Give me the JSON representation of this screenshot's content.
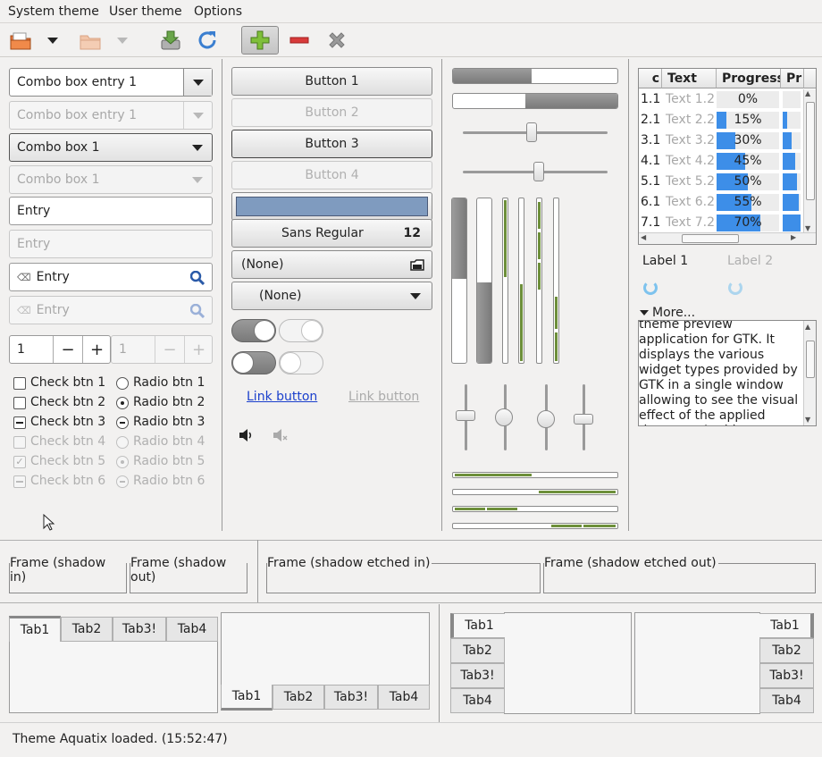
{
  "menubar": {
    "items": [
      "System theme",
      "User theme",
      "Options"
    ]
  },
  "toolbar": {
    "icons": [
      "open-icon",
      "dropdown-arrow-icon",
      "open-disabled-icon",
      "dropdown-arrow-disabled-icon",
      "save-icon",
      "refresh-icon",
      "add-icon",
      "remove-icon",
      "close-icon"
    ]
  },
  "col1": {
    "combo_entry_1": "Combo box entry 1",
    "combo_entry_1_dis": "Combo box entry 1",
    "combo_1": "Combo box 1",
    "combo_1_dis": "Combo box 1",
    "entry": "Entry",
    "entry_placeholder": "Entry",
    "search_entry": "Entry",
    "search_entry_dis": "Entry",
    "spin_value": "1",
    "spin_value_dis": "1",
    "spin_minus": "−",
    "spin_plus": "+",
    "checks": [
      "Check btn 1",
      "Check btn 2",
      "Check btn 3",
      "Check btn 4",
      "Check btn 5",
      "Check btn 6"
    ],
    "radios": [
      "Radio btn 1",
      "Radio btn 2",
      "Radio btn 3",
      "Radio btn 4",
      "Radio btn 5",
      "Radio btn 6"
    ]
  },
  "col2": {
    "buttons": [
      "Button 1",
      "Button 2",
      "Button 3",
      "Button 4"
    ],
    "color_button": "#7f9bbf",
    "font_name": "Sans Regular",
    "font_size": "12",
    "file_chooser": "(None)",
    "app_chooser": "(None)",
    "link_1": "Link button",
    "link_2": "Link button"
  },
  "col3": {
    "progress_1": 0.48,
    "progress_2": 0.48
  },
  "tree": {
    "headers": [
      "Text",
      "Progress",
      "Pr"
    ],
    "rows": [
      {
        "a": "1.1",
        "b": "Text 1.2",
        "p": "0%",
        "v": 0
      },
      {
        "a": "2.1",
        "b": "Text 2.2",
        "p": "15%",
        "v": 15
      },
      {
        "a": "3.1",
        "b": "Text 3.2",
        "p": "30%",
        "v": 30
      },
      {
        "a": "4.1",
        "b": "Text 4.2",
        "p": "45%",
        "v": 45
      },
      {
        "a": "5.1",
        "b": "Text 5.2",
        "p": "50%",
        "v": 50
      },
      {
        "a": "6.1",
        "b": "Text 6.2",
        "p": "55%",
        "v": 55
      },
      {
        "a": "7.1",
        "b": "Text 7.2",
        "p": "70%",
        "v": 70
      }
    ]
  },
  "labels": {
    "label_1": "Label 1",
    "label_2": "Label 2",
    "expander": "More..."
  },
  "textview": "theme preview application for GTK. It displays the various widget types provided by GTK in a single window allowing to see the visual effect of the applied theme. ~ A widget factory",
  "frames": [
    "Frame (shadow in)",
    "Frame (shadow out)",
    "Frame (shadow etched in)",
    "Frame (shadow etched out)"
  ],
  "tabs": [
    "Tab1",
    "Tab2",
    "Tab3!",
    "Tab4"
  ],
  "status": "Theme Aquatix loaded.  (15:52:47)",
  "colors": {
    "accent_blue": "#3d8ee8",
    "green": "#6d8f3a",
    "link": "#1a3fcc"
  }
}
